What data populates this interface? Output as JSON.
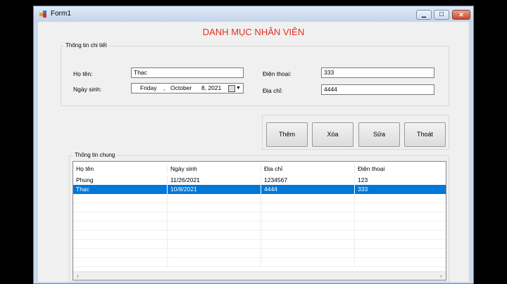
{
  "window": {
    "title": "Form1",
    "minimize_glyph": "▁",
    "maximize_glyph": "□",
    "close_glyph": "✕"
  },
  "heading": "DANH MỤC NHÂN VIÊN",
  "details_group": {
    "title": "Thông tin chi tiết",
    "name_label": "Họ tên:",
    "name_value": "Thạc",
    "dob_label": "Ngày sinh:",
    "dob_day": "Friday",
    "dob_sep": ",",
    "dob_month": "October",
    "dob_rest": "8, 2021",
    "phone_label": "Điện thoại:",
    "phone_value": "333",
    "address_label": "Địa chỉ:",
    "address_value": "4444"
  },
  "buttons": {
    "add": "Thêm",
    "delete": "Xóa",
    "edit": "Sửa",
    "exit": "Thoát"
  },
  "general_group": {
    "title": "Thông tin chung",
    "columns": [
      "Họ tên",
      "Ngày sinh",
      "Địa chỉ",
      "Điện thoại"
    ],
    "rows": [
      [
        "Phung",
        "11/26/2021",
        "1234567",
        "123"
      ],
      [
        "Thạc",
        "10/8/2021",
        "4444",
        "333"
      ]
    ],
    "selected_row": 1,
    "scroll_left": "‹",
    "scroll_right": "›"
  }
}
